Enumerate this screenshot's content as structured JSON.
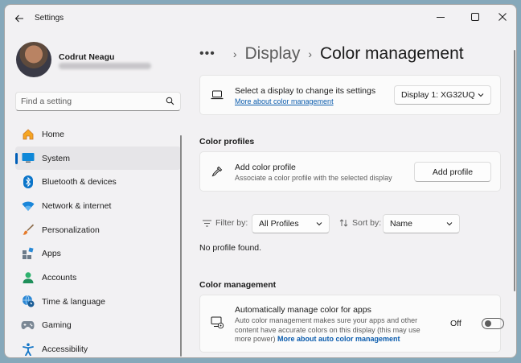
{
  "app": {
    "title": "Settings"
  },
  "user": {
    "name": "Codrut Neagu"
  },
  "search": {
    "placeholder": "Find a setting"
  },
  "sidebar": {
    "items": [
      {
        "label": "Home",
        "icon": "home-icon"
      },
      {
        "label": "System",
        "icon": "system-icon",
        "selected": true
      },
      {
        "label": "Bluetooth & devices",
        "icon": "bluetooth-icon"
      },
      {
        "label": "Network & internet",
        "icon": "wifi-icon"
      },
      {
        "label": "Personalization",
        "icon": "brush-icon"
      },
      {
        "label": "Apps",
        "icon": "apps-icon"
      },
      {
        "label": "Accounts",
        "icon": "person-icon"
      },
      {
        "label": "Time & language",
        "icon": "globe-clock-icon"
      },
      {
        "label": "Gaming",
        "icon": "gamepad-icon"
      },
      {
        "label": "Accessibility",
        "icon": "accessibility-icon"
      }
    ]
  },
  "breadcrumb": {
    "dots": "•••",
    "parent": "Display",
    "current": "Color management"
  },
  "display_card": {
    "title": "Select a display to change its settings",
    "link": "More about color management",
    "dropdown_value": "Display 1: XG32UQ"
  },
  "color_profiles": {
    "section_title": "Color profiles",
    "add_title": "Add color profile",
    "add_desc": "Associate a color profile with the selected display",
    "add_button": "Add profile",
    "filter_label": "Filter by:",
    "filter_value": "All Profiles",
    "sort_label": "Sort by:",
    "sort_value": "Name",
    "empty_text": "No profile found."
  },
  "color_management": {
    "section_title": "Color management",
    "auto_title": "Automatically manage color for apps",
    "auto_desc": "Auto color management makes sure your apps and other content have accurate colors on this display (this may use more power)",
    "auto_link": "More about auto color management",
    "toggle_state": "Off"
  },
  "colors": {
    "accent": "#005fb8",
    "link": "#0b5cad"
  }
}
